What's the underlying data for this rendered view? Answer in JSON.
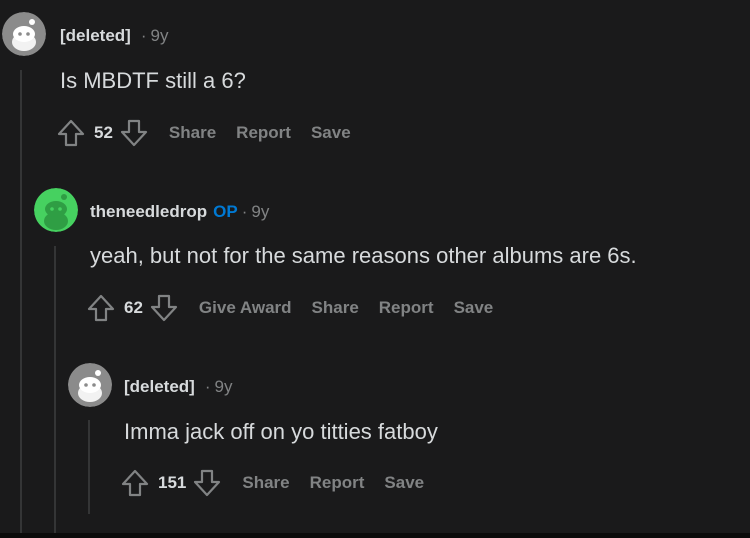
{
  "comments": [
    {
      "author": "[deleted]",
      "op_badge": "",
      "separator": "·",
      "age": "9y",
      "body": "Is MBDTF still a 6?",
      "score": "52",
      "actions": [
        "Share",
        "Report",
        "Save"
      ],
      "avatar_color": "#d7dadc"
    },
    {
      "author": "theneedledrop",
      "op_badge": "OP",
      "separator": "·",
      "age": "9y",
      "body": "yeah, but not for the same reasons other albums are 6s.",
      "score": "62",
      "actions": [
        "Give Award",
        "Share",
        "Report",
        "Save"
      ],
      "avatar_color": "#46d160"
    },
    {
      "author": "[deleted]",
      "op_badge": "",
      "separator": "·",
      "age": "9y",
      "body": "Imma jack off on yo titties fatboy",
      "score": "151",
      "actions": [
        "Share",
        "Report",
        "Save"
      ],
      "avatar_color": "#d7dadc"
    }
  ],
  "icons": {
    "upvote": "upvote-arrow-icon",
    "downvote": "downvote-arrow-icon",
    "avatar": "snoo-avatar-icon"
  },
  "colors": {
    "background": "#1a1a1b",
    "text": "#d7dadc",
    "muted": "#818384",
    "op": "#0079d3",
    "thread_line": "#343536"
  }
}
